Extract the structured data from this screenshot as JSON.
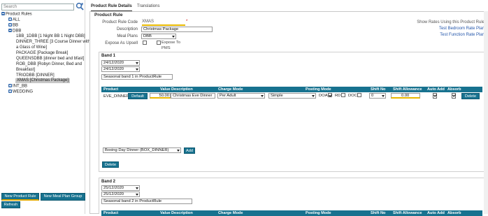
{
  "sidebar": {
    "search_placeholder": "Search",
    "tree": {
      "root": "Product Rules",
      "all": "ALL",
      "bb": "BB",
      "dbb": "DBB",
      "dbb_children": [
        "1BB_1DBB [1 Night BB 1 Night DBB]",
        "DINNER_THREE [3 Course Dinner with",
        "a Glass of Wine]",
        "PACKAGE [Package Break]",
        "QUEENSDBB [dinner bed and bfast]",
        "ROB_DBB [Robyn Dinner, Bed and",
        "Breakfast]",
        "TRIODBB [DINNER]",
        "XMAS [Christmas Package]"
      ],
      "int_bb": "INT_BB",
      "wedding": "WEDDING"
    },
    "buttons": {
      "new_rule": "New Product Rule",
      "new_group": "New Meal Plan Group",
      "refresh": "Refresh"
    }
  },
  "tabs": [
    "Product Rule Details",
    "Translations"
  ],
  "rule": {
    "section_title": "Product Rule",
    "code_label": "Product Rule Code",
    "code_value": "XMAS",
    "required_mark": "*",
    "desc_label": "Description",
    "desc_value": "Christmas Package",
    "meal_label": "Meal Plans",
    "meal_value": "DBB",
    "upsell_label": "Expose As Upsell",
    "expose_label": "Expose To",
    "pms_label": "PMS",
    "links": [
      "Show Rates Using this Product Rule",
      "Test Bedroom Rate Plan",
      "Test Function Rate Plan"
    ]
  },
  "band1": {
    "title": "Band 1",
    "date_from": "24/12/2020",
    "date_to": "24/12/2020",
    "description": "Seasonal band 1 in ProductRule",
    "headers": [
      "Product",
      "Value",
      "Description",
      "Charge Mode",
      "Posting Mode",
      "Shift No",
      "Shift Allowance",
      "Auto Add",
      "Absorb"
    ],
    "row": {
      "product": "EVE_DINNER",
      "default_label": "Default",
      "value": "50.00",
      "description": "Christmas Eve Dinner",
      "charge_mode": "Per Adult",
      "posting_mode": "Simple",
      "doa": "DOA",
      "rd": "RD",
      "doc": "DOC",
      "shift_no": "0",
      "shift_allowance": "0.00",
      "delete": "Delete"
    },
    "add_select": "Boxing Day Dinner (BOX_DINNER)",
    "add_label": "Add",
    "delete_label": "Delete"
  },
  "band2": {
    "title": "Band 2",
    "date_from": "25/12/2020",
    "date_to": "25/12/2020",
    "description": "Seasonal band 2 in ProductRule",
    "headers": [
      "Product",
      "Value",
      "Description",
      "Charge Mode",
      "Posting Mode",
      "Shift No",
      "Shift Allowance",
      "Auto Add",
      "Absorb"
    ]
  },
  "colors": {
    "accent": "#17728f",
    "highlight": "#e8b800",
    "link": "#2255aa"
  }
}
